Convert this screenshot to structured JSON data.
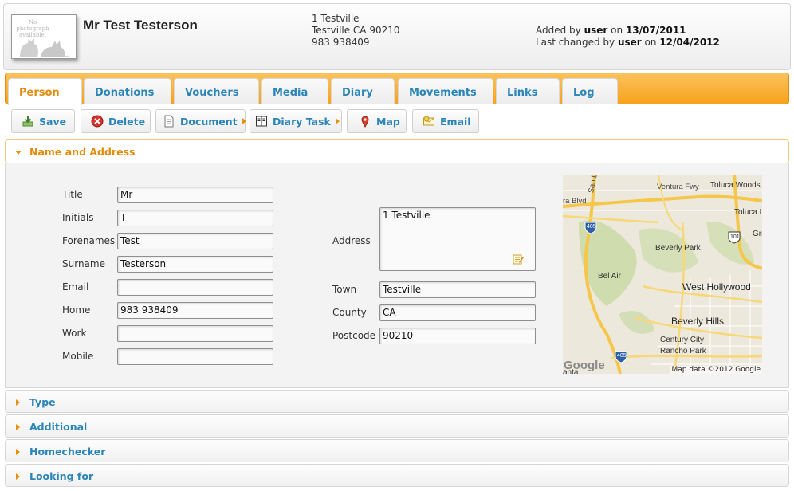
{
  "header": {
    "photo_text": "No photograph available.",
    "name": "Mr Test Testerson",
    "address_line1": "1 Testville",
    "address_line2": "Testville CA 90210",
    "phone": "983 938409",
    "added_prefix": "Added by",
    "added_user": "user",
    "added_on": "on",
    "added_date": "13/07/2011",
    "changed_prefix": "Last changed by",
    "changed_user": "user",
    "changed_on": "on",
    "changed_date": "12/04/2012"
  },
  "tabs": [
    {
      "label": "Person",
      "active": true
    },
    {
      "label": "Donations"
    },
    {
      "label": "Vouchers"
    },
    {
      "label": "Media"
    },
    {
      "label": "Diary"
    },
    {
      "label": "Movements"
    },
    {
      "label": "Links"
    },
    {
      "label": "Log"
    }
  ],
  "toolbar": {
    "save": "Save",
    "delete": "Delete",
    "document": "Document",
    "diary_task": "Diary Task",
    "map": "Map",
    "email": "Email"
  },
  "sections": {
    "name_address": "Name and Address",
    "type": "Type",
    "additional": "Additional",
    "homechecker": "Homechecker",
    "looking_for": "Looking for"
  },
  "form": {
    "title_label": "Title",
    "title": "Mr",
    "initials_label": "Initials",
    "initials": "T",
    "forenames_label": "Forenames",
    "forenames": "Test",
    "surname_label": "Surname",
    "surname": "Testerson",
    "email_label": "Email",
    "email": "",
    "home_label": "Home",
    "home": "983 938409",
    "work_label": "Work",
    "work": "",
    "mobile_label": "Mobile",
    "mobile": "",
    "address_label": "Address",
    "address": "1 Testville",
    "town_label": "Town",
    "town": "Testville",
    "county_label": "County",
    "county": "CA",
    "postcode_label": "Postcode",
    "postcode": "90210"
  },
  "map": {
    "labels": {
      "ventura_fwy": "Ventura Fwy",
      "toluca_woods": "Toluca Woods",
      "toluca_lake": "Toluca Lak",
      "san_diego_fwy": "San Diego Fwy",
      "tara_blvd": "ra Blvd",
      "beverly_park": "Beverly Park",
      "bel_air": "Bel Air",
      "west_hollywood": "West Hollywood",
      "beverly_hills": "Beverly Hills",
      "century_city": "Century City",
      "rancho_park": "Rancho Park",
      "griffith": "Grif",
      "santa": "anta",
      "shield_405": "405",
      "shield_101": "101"
    },
    "google": "Google",
    "attribution": "Map data ©2012 Google"
  }
}
